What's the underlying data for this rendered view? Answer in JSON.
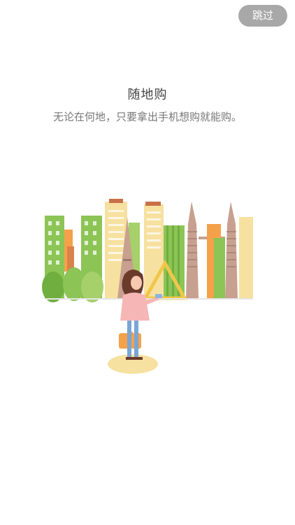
{
  "skip_button": {
    "label": "跳过"
  },
  "onboarding": {
    "title": "随地购",
    "subtitle": "无论在何地，只要拿出手机想购就能购。"
  },
  "illustration": {
    "icon": "city-shopping-illustration"
  }
}
